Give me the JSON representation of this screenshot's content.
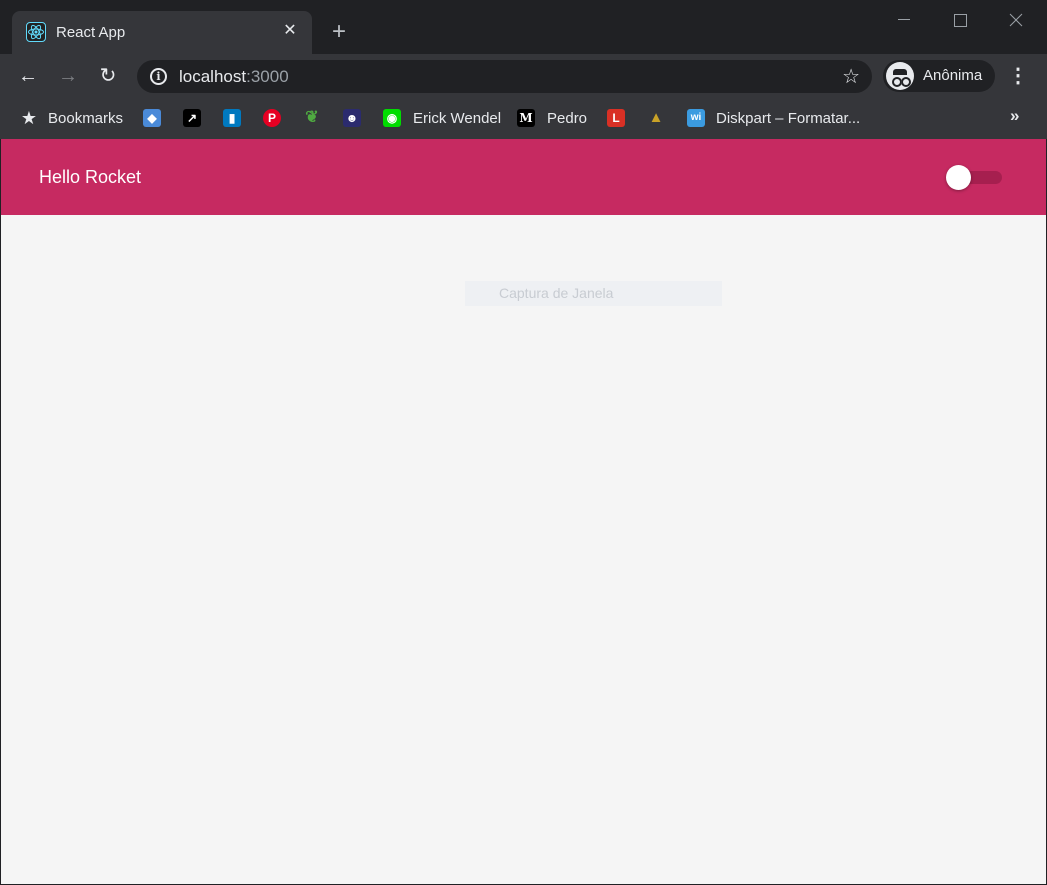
{
  "browser": {
    "tab": {
      "title": "React App",
      "favicon": "react-atom-icon"
    },
    "new_tab": "+",
    "tab_close": "✕",
    "address": {
      "host": "localhost",
      "port": ":3000"
    },
    "profile": {
      "label": "Anônima",
      "icon": "incognito-icon"
    },
    "menu": "⋮",
    "nav": {
      "back": "←",
      "forward": "→",
      "reload": "↻"
    }
  },
  "bookmarks": {
    "folder_label": "Bookmarks",
    "items": [
      {
        "label": "",
        "icon": "map-icon",
        "color": "#4a8ad8"
      },
      {
        "label": "",
        "icon": "arrow-icon",
        "color": "#000000"
      },
      {
        "label": "",
        "icon": "trello-icon",
        "color": "#0079bf"
      },
      {
        "label": "",
        "icon": "pinterest-icon",
        "color": "#e60023"
      },
      {
        "label": "",
        "icon": "mongodb-leaf-icon",
        "color": "#4faa41"
      },
      {
        "label": "",
        "icon": "robot-icon",
        "color": "#2b2b6e"
      },
      {
        "label": "Erick Wendel",
        "icon": "erick-wendel-icon",
        "color": "#00dd00"
      },
      {
        "label": "Pedro",
        "icon": "medium-icon",
        "color": "#000000"
      },
      {
        "label": "",
        "icon": "l-letter-icon",
        "color": "#d93025"
      },
      {
        "label": "",
        "icon": "graduation-cap-icon",
        "color": "#c9a227"
      },
      {
        "label": "Diskpart – Formatar...",
        "icon": "wix-icon",
        "color": "#3b9be0"
      }
    ],
    "more": "»"
  },
  "app": {
    "title": "Hello Rocket",
    "theme_toggle": {
      "on": false
    },
    "colors": {
      "header": "#c62a61",
      "background": "#f5f5f5"
    }
  },
  "overlay": {
    "capture_label": "Captura de Janela"
  }
}
